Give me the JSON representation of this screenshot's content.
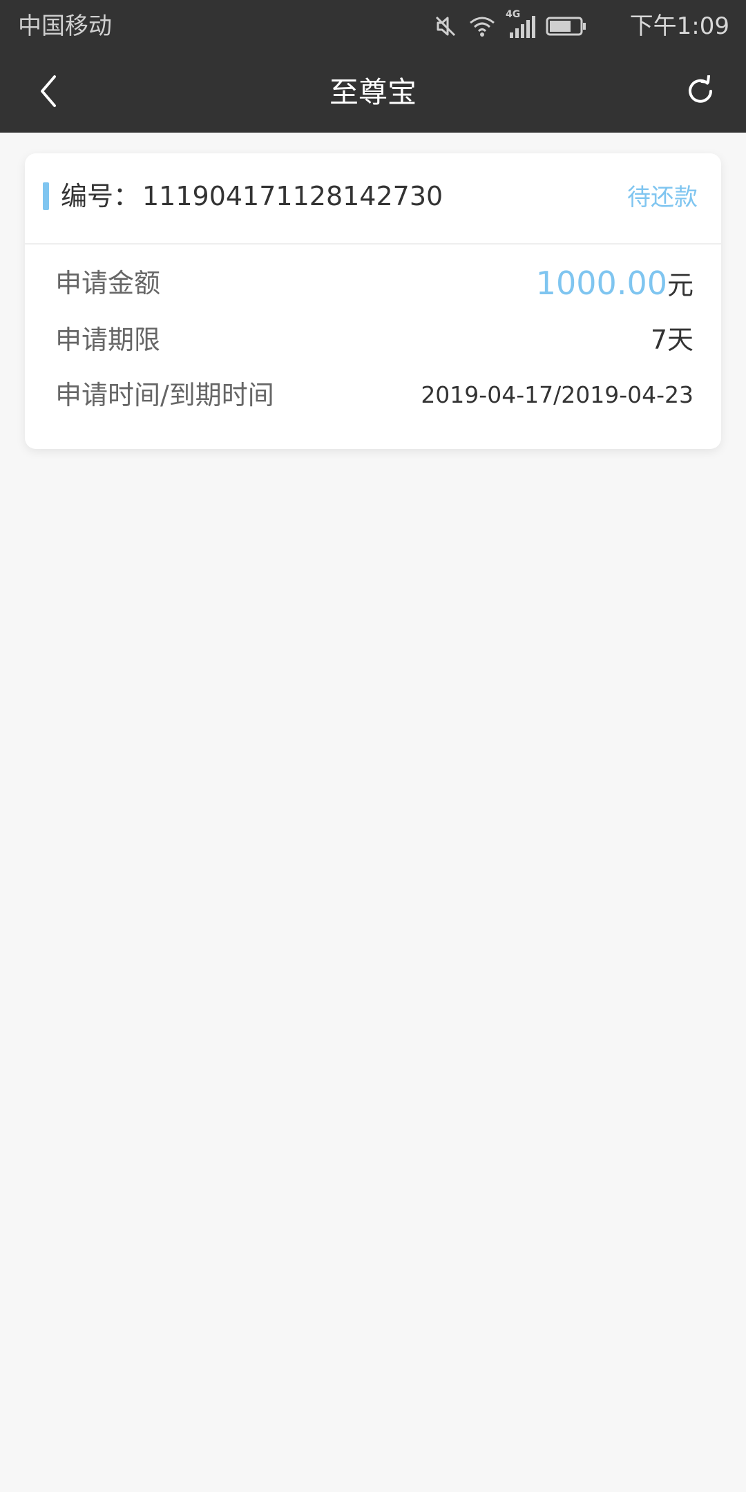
{
  "status_bar": {
    "carrier": "中国移动",
    "network": "4G",
    "time": "下午1:09"
  },
  "nav": {
    "title": "至尊宝"
  },
  "order": {
    "number_label": "编号：",
    "number": "111904171128142730",
    "status": "待还款",
    "rows": [
      {
        "label": "申请金额",
        "value": "1000.00",
        "unit": "元"
      },
      {
        "label": "申请期限",
        "value": "7天"
      },
      {
        "label": "申请时间/到期时间",
        "value": "2019-04-17/2019-04-23"
      }
    ]
  },
  "colors": {
    "header_bg": "#333333",
    "accent": "#7fc5f0",
    "page_bg": "#f7f7f7"
  },
  "icons": {
    "status": [
      "mute-icon",
      "wifi-icon",
      "signal-icon",
      "battery-icon"
    ],
    "nav_left": "back-chevron-icon",
    "nav_right": "refresh-icon"
  }
}
